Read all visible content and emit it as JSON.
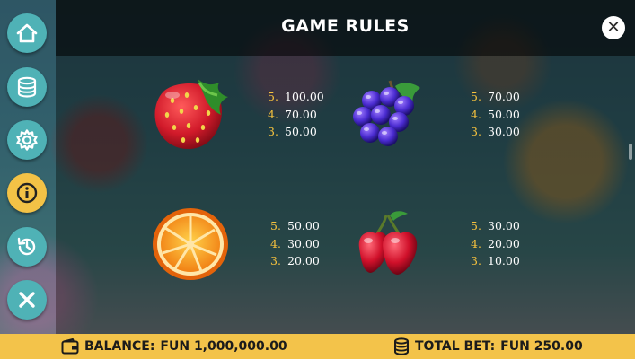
{
  "header": {
    "title": "GAME RULES",
    "close_label": "✕"
  },
  "sidebar": {
    "buttons": [
      {
        "name": "home-button",
        "icon": "home-icon"
      },
      {
        "name": "bet-settings-button",
        "icon": "coin-stack-icon"
      },
      {
        "name": "settings-button",
        "icon": "gear-icon"
      },
      {
        "name": "info-button",
        "icon": "info-icon",
        "active": true
      },
      {
        "name": "history-button",
        "icon": "history-icon"
      },
      {
        "name": "close-menu-button",
        "icon": "close-icon"
      }
    ]
  },
  "paytable": {
    "symbols": [
      {
        "name": "strawberry",
        "pays": [
          {
            "count": "5.",
            "value": "100.00"
          },
          {
            "count": "4.",
            "value": "70.00"
          },
          {
            "count": "3.",
            "value": "50.00"
          }
        ]
      },
      {
        "name": "grapes",
        "pays": [
          {
            "count": "5.",
            "value": "70.00"
          },
          {
            "count": "4.",
            "value": "50.00"
          },
          {
            "count": "3.",
            "value": "30.00"
          }
        ]
      },
      {
        "name": "orange",
        "pays": [
          {
            "count": "5.",
            "value": "50.00"
          },
          {
            "count": "4.",
            "value": "30.00"
          },
          {
            "count": "3.",
            "value": "20.00"
          }
        ]
      },
      {
        "name": "cherry",
        "pays": [
          {
            "count": "5.",
            "value": "30.00"
          },
          {
            "count": "4.",
            "value": "20.00"
          },
          {
            "count": "3.",
            "value": "10.00"
          }
        ]
      }
    ]
  },
  "footer": {
    "balance_label": "BALANCE:",
    "balance_value": "FUN 1,000,000.00",
    "total_bet_label": "TOTAL BET:",
    "total_bet_value": "FUN 250.00"
  },
  "colors": {
    "accent": "#f3c34a",
    "sidebar_button": "#4fb2b6",
    "multiplier": "#f6c23e"
  }
}
